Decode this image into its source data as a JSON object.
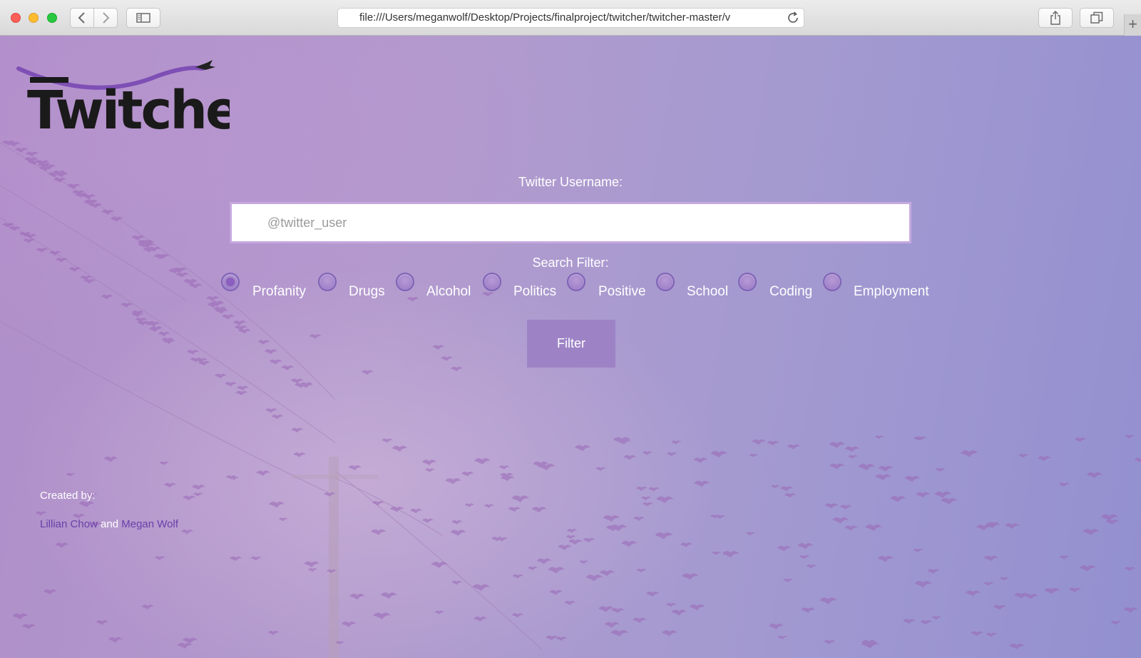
{
  "browser": {
    "url": "file:///Users/meganwolf/Desktop/Projects/finalproject/twitcher/twitcher-master/v"
  },
  "logo": {
    "text": "Twitcher"
  },
  "form": {
    "username_label": "Twitter Username:",
    "username_placeholder": "@twitter_user",
    "filter_label": "Search Filter:",
    "options": [
      {
        "label": "Profanity",
        "checked": true
      },
      {
        "label": "Drugs",
        "checked": false
      },
      {
        "label": "Alcohol",
        "checked": false
      },
      {
        "label": "Politics",
        "checked": false
      },
      {
        "label": "Positive",
        "checked": false
      },
      {
        "label": "School",
        "checked": false
      },
      {
        "label": "Coding",
        "checked": false
      },
      {
        "label": "Employment",
        "checked": false
      }
    ],
    "submit_label": "Filter"
  },
  "credits": {
    "title": "Created by:",
    "author1": "Lillian Chow",
    "conjunction": "and",
    "author2": "Megan Wolf"
  },
  "colors": {
    "accent": "#9d83c6",
    "link": "#6a3fa8"
  }
}
